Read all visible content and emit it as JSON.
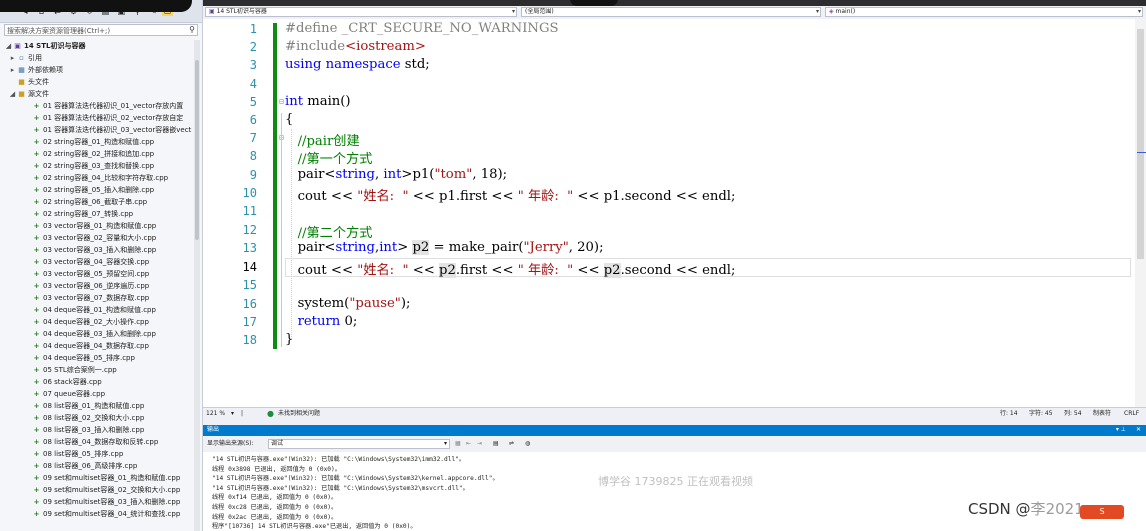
{
  "solution_explorer": {
    "search_placeholder": "搜索解决方案资源管理器(Ctrl+;)",
    "project": "14 STL初识与容器",
    "references": "引用",
    "external_deps": "外部依赖项",
    "headers": "头文件",
    "sources": "源文件",
    "files": [
      "01 容器算法迭代器初识_01_vector存放内置",
      "01 容器算法迭代器初识_02_vector存放自定",
      "01 容器算法迭代器初识_03_vector容器嵌vect",
      "02 string容器_01_构造和赋值.cpp",
      "02 string容器_02_拼接和追加.cpp",
      "02 string容器_03_查找和替换.cpp",
      "02 string容器_04_比较和字符存取.cpp",
      "02 string容器_05_插入和删除.cpp",
      "02 string容器_06_截取子串.cpp",
      "02 string容器_07_转换.cpp",
      "03 vector容器_01_构造和赋值.cpp",
      "03 vector容器_02_容量和大小.cpp",
      "03 vector容器_03_插入和删除.cpp",
      "03 vector容器_04_容器交换.cpp",
      "03 vector容器_05_预留空间.cpp",
      "03 vector容器_06_逆序遍历.cpp",
      "03 vector容器_07_数据存取.cpp",
      "04 deque容器_01_构造和赋值.cpp",
      "04 deque容器_02_大小操作.cpp",
      "04 deque容器_03_插入和删除.cpp",
      "04 deque容器_04_数据存取.cpp",
      "04 deque容器_05_排序.cpp",
      "05 STL综合案例一.cpp",
      "06 stack容器.cpp",
      "07 queue容器.cpp",
      "08 list容器_01_构造和赋值.cpp",
      "08 list容器_02_交换和大小.cpp",
      "08 list容器_03_插入和删除.cpp",
      "08 list容器_04_数据存取和反转.cpp",
      "08 list容器_05_排序.cpp",
      "08 list容器_06_高级排序.cpp",
      "09 set和multiset容器_01_构造和赋值.cpp",
      "09 set和multiset容器_02_交换和大小.cpp",
      "09 set和multiset容器_03_插入和删除.cpp",
      "09 set和multiset容器_04_统计和查找.cpp"
    ]
  },
  "editor_nav": {
    "project_combo": "14 STL初识与容器",
    "scope_combo": "(全局范围)",
    "member_combo": "main()"
  },
  "code": {
    "line_numbers": [
      "1",
      "2",
      "3",
      "4",
      "5",
      "6",
      "7",
      "8",
      "9",
      "10",
      "11",
      "12",
      "13",
      "14",
      "15",
      "16",
      "17",
      "18"
    ],
    "l1_a": "#define ",
    "l1_b": "_CRT_SECURE_NO_WARNINGS",
    "l2_a": "#include",
    "l2_b": "<iostream>",
    "l3_a": "using",
    "l3_b": "namespace",
    "l3_c": " std;",
    "l5_a": "int",
    "l5_b": " main()",
    "l6": "{",
    "l7": "//pair创建",
    "l8": "//第一个方式",
    "l9_a": "pair<",
    "l9_b": "string",
    "l9_c": ", ",
    "l9_d": "int",
    "l9_e": ">p1(",
    "l9_f": "\"tom\"",
    "l9_g": ", 18);",
    "l10_a": "cout << ",
    "l10_b": "\"姓名:  \"",
    "l10_c": " << p1.first << ",
    "l10_d": "\" 年龄:  \"",
    "l10_e": " << p1.second << endl;",
    "l12": "//第二个方式",
    "l13_a": "pair<",
    "l13_b": "string",
    "l13_c": ",",
    "l13_d": "int",
    "l13_e": "> ",
    "l13_f": "p2",
    "l13_g": " = make_pair(",
    "l13_h": "\"Jerry\"",
    "l13_i": ", 20);",
    "l14_a": "cout << ",
    "l14_b": "\"姓名:  \"",
    "l14_c": " << ",
    "l14_d": "p2",
    "l14_e": ".first << ",
    "l14_f": "\" 年龄:  \"",
    "l14_g": " << ",
    "l14_h": "p2",
    "l14_i": ".second << endl;",
    "l16_a": "system(",
    "l16_b": "\"pause\"",
    "l16_c": ");",
    "l17_a": "return",
    "l17_b": " 0;",
    "l18": "}"
  },
  "editor_status": {
    "zoom": "121 %",
    "issues": "未找到相关问题",
    "line": "行: 14",
    "char": "字符: 45",
    "col": "列: 54",
    "mode": "制表符",
    "eol": "CRLF"
  },
  "output": {
    "title": "输出",
    "show_from_label": "显示输出来源(S):",
    "source": "调试",
    "lines": [
      "\"14 STL初识与容器.exe\"(Win32): 已加载 \"C:\\Windows\\System32\\imm32.dll\"。",
      "线程 0x3898 已退出, 返回值为 0 (0x0)。",
      "\"14 STL初识与容器.exe\"(Win32): 已加载 \"C:\\Windows\\System32\\kernel.appcore.dll\"。",
      "\"14 STL初识与容器.exe\"(Win32): 已加载 \"C:\\Windows\\System32\\msvcrt.dll\"。",
      "线程 0xf14 已退出, 返回值为 0 (0x0)。",
      "线程 0xc28 已退出, 返回值为 0 (0x0)。",
      "线程 0x2ac 已退出, 返回值为 0 (0x0)。",
      "程序\"[10736] 14 STL初识与容器.exe\"已退出, 返回值为 0 (0x0)。"
    ]
  },
  "watermark": "博学谷 1739825 正在观看视频",
  "csdn": {
    "prefix": "CSDN @",
    "name": "李",
    "suffix": "2021"
  }
}
